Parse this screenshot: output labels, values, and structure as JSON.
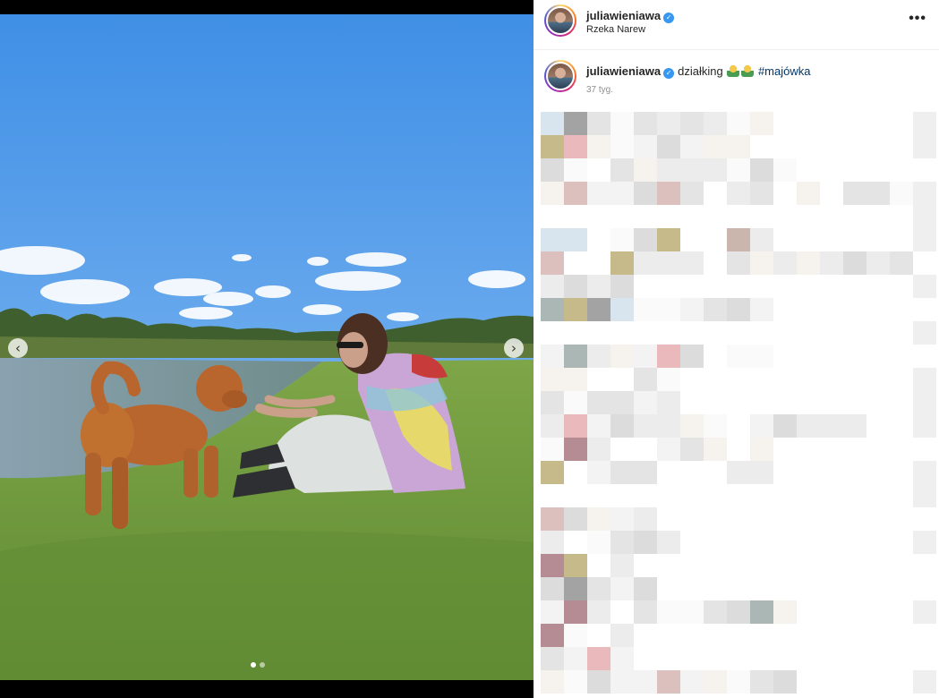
{
  "post": {
    "username": "juliawieniawa",
    "verified": true,
    "location": "Rzeka Narew",
    "caption_text": "działking",
    "caption_emoji": [
      "woman-farmer-emoji",
      "woman-farmer-emoji"
    ],
    "hashtag": "#majówka",
    "time_ago": "37 tyg."
  },
  "icons": {
    "more": "more-options-icon",
    "prev": "chevron-left-icon",
    "next": "chevron-right-icon",
    "verified": "verified-badge-icon"
  },
  "symbols": {
    "more": "•••",
    "prev": "‹",
    "next": "›",
    "check": "✓"
  },
  "carousel": {
    "slides": 2,
    "active": 0
  },
  "colors": {
    "verified": "#3897f0",
    "hashtag": "#00376b",
    "sky": "#5aa2ea",
    "grass": "#6f9a3c"
  },
  "comments_blurred": true
}
